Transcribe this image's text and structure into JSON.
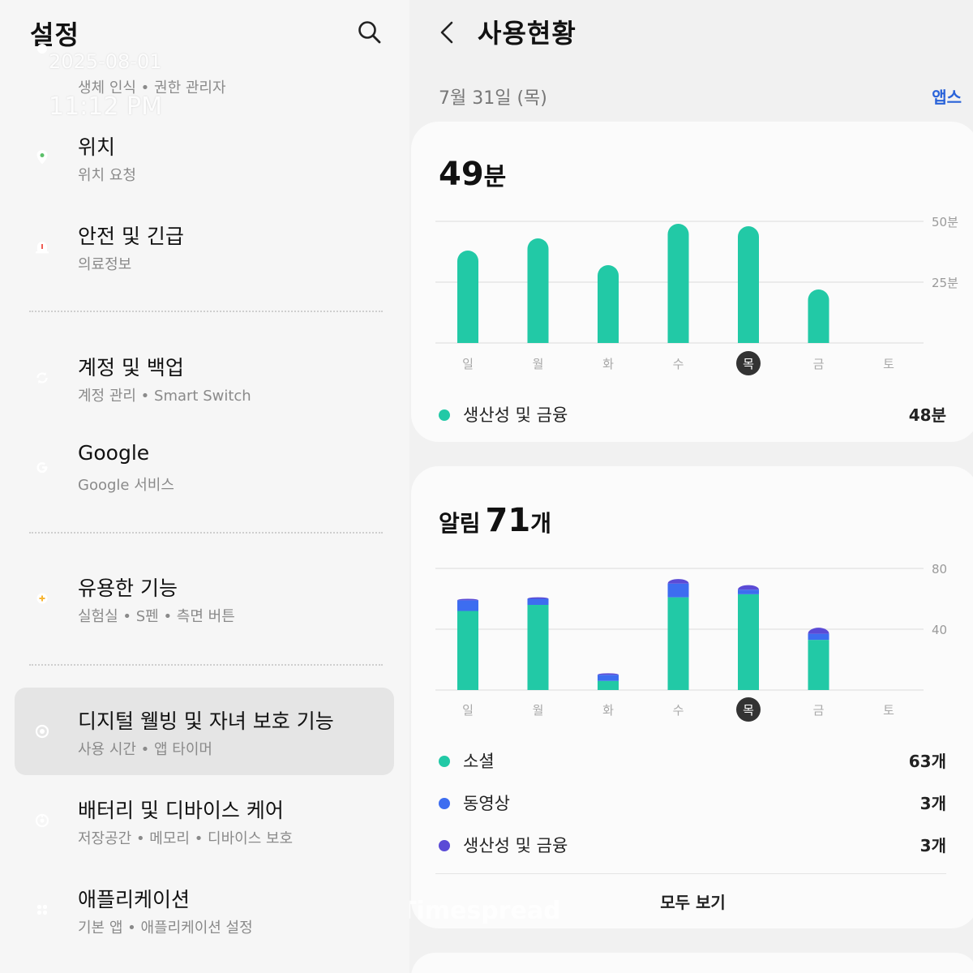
{
  "settings": {
    "title": "설정",
    "overlay": {
      "date": "2025-08-01",
      "time": "11:12 PM"
    },
    "items": [
      {
        "title": "",
        "subtitle": "생체 인식 • 권한 관리자",
        "color": "#7b74e8"
      },
      {
        "title": "위치",
        "subtitle": "위치 요청",
        "color": "#5cc06a"
      },
      {
        "title": "안전 및 긴급",
        "subtitle": "의료정보",
        "color": "#ef5d55"
      },
      {
        "title": "계정 및 백업",
        "subtitle": "계정 관리 • Smart Switch",
        "color": "#3f6ee8"
      },
      {
        "title": "Google",
        "subtitle": "Google 서비스",
        "color": "#3f84f2"
      },
      {
        "title": "유용한 기능",
        "subtitle": "실험실 • S펜 • 측면 버튼",
        "color": "#f7b533"
      },
      {
        "title": "디지털 웰빙 및 자녀 보호 기능",
        "subtitle": "사용 시간 • 앱 타이머",
        "color": "#3fbd73"
      },
      {
        "title": "배터리 및 디바이스 케어",
        "subtitle": "저장공간 • 메모리 • 디바이스 보호",
        "color": "#1ab79a"
      },
      {
        "title": "애플리케이션",
        "subtitle": "기본 앱 • 애플리케이션 설정",
        "color": "#5b9cf0"
      }
    ]
  },
  "usage": {
    "title": "사용현황",
    "date": "7월 31일 (목)",
    "apps_link": "앱스",
    "screen_time": {
      "value": "49",
      "unit": "분"
    },
    "notifications": {
      "label": "알림",
      "value": "71",
      "unit": "개"
    },
    "see_all": "모두 보기",
    "watermark": "Timespread"
  },
  "chart_data": [
    {
      "type": "bar",
      "title": "49분",
      "categories": [
        "일",
        "월",
        "화",
        "수",
        "목",
        "금",
        "토"
      ],
      "selected": "목",
      "y_ticks": [
        "25분",
        "50분"
      ],
      "ylim": [
        0,
        50
      ],
      "series": [
        {
          "name": "생산성 및 금융",
          "color": "#22c9a6",
          "values": [
            38,
            43,
            32,
            49,
            48,
            22,
            0
          ]
        }
      ],
      "legend": [
        {
          "name": "생산성 및 금융",
          "value": "48분",
          "color": "#22c9a6"
        }
      ]
    },
    {
      "type": "bar",
      "title": "알림 71개",
      "categories": [
        "일",
        "월",
        "화",
        "수",
        "목",
        "금",
        "토"
      ],
      "selected": "목",
      "y_ticks": [
        "40",
        "80"
      ],
      "ylim": [
        0,
        80
      ],
      "stacked": true,
      "series": [
        {
          "name": "소셜",
          "color": "#22c9a6",
          "values": [
            52,
            56,
            6,
            61,
            63,
            33,
            0
          ]
        },
        {
          "name": "동영상",
          "color": "#3d6df0",
          "values": [
            7,
            4,
            4,
            9,
            3,
            4,
            0
          ]
        },
        {
          "name": "생산성 및 금융",
          "color": "#5b4bd6",
          "values": [
            1,
            1,
            1,
            3,
            3,
            4,
            0
          ]
        }
      ],
      "legend": [
        {
          "name": "소셜",
          "value": "63개",
          "color": "#22c9a6"
        },
        {
          "name": "동영상",
          "value": "3개",
          "color": "#3d6df0"
        },
        {
          "name": "생산성 및 금융",
          "value": "3개",
          "color": "#5b4bd6"
        }
      ]
    }
  ]
}
